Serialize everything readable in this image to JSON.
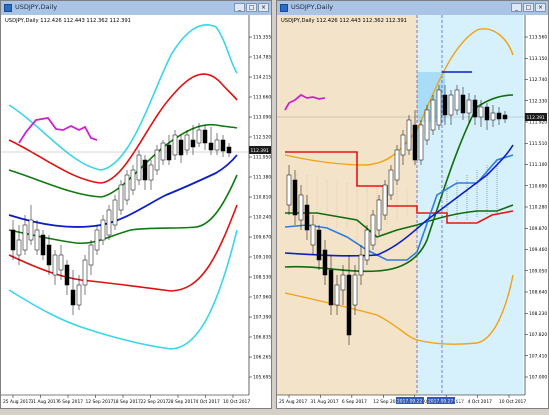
{
  "colors": {
    "bb1": "#39d7e6",
    "bb2": "#e01010",
    "bb3": "#0f7a0f",
    "mid": "#0b1ec8",
    "lagging": "#cc22cc",
    "candle_dark": "#000000",
    "candle_light": "#ffffff",
    "cloud_tan": "#f3e3c8",
    "cloud_cyan": "#bfeafb",
    "kijun": "#e81515",
    "tenkan": "#2d7de0",
    "senkou": "#0e6e0e",
    "orange": "#f3a212",
    "price_box": "#1c1c1c"
  },
  "left_window": {
    "title": "USDJPY,Daily",
    "header": "USDJPY,Daily  112.426 112.443 112.362 112.391",
    "price_label": "112.391",
    "y_ticks": [
      "115.355",
      "114.785",
      "114.215",
      "113.660",
      "113.090",
      "112.520",
      "111.950",
      "111.380",
      "110.810",
      "110.240",
      "109.670",
      "109.100",
      "108.530",
      "107.960",
      "107.390",
      "106.835",
      "106.265",
      "105.695"
    ],
    "x_ticks": [
      "25 Aug 2017",
      "31 Aug 2017",
      "6 Sep 2017",
      "12 Sep 2017",
      "18 Sep 2017",
      "22 Sep 2017",
      "28 Sep 2017",
      "4 Oct 2017",
      "10 Oct 2017"
    ]
  },
  "right_window": {
    "title": "USDJPY,Daily",
    "header": "USDJPY,Daily  112.426 112.443 112.362 112.391",
    "price_label": "112.391",
    "y_ticks": [
      "113.560",
      "113.150",
      "112.740",
      "112.330",
      "111.920",
      "111.510",
      "111.100",
      "110.690",
      "110.280",
      "109.870",
      "109.460",
      "109.050",
      "108.640",
      "108.230",
      "107.820",
      "107.410",
      "107.000"
    ],
    "x_ticks": [
      "25 Aug 2017",
      "31 Aug 2017",
      "6 Sep 2017",
      "12 Sep 2017",
      "18 Sep 2017",
      "26 Sep 2017",
      "4 Oct 2017",
      "10 Oct 2017"
    ],
    "highlight_label_1": "2017.09.22 00:00",
    "highlight_label_2": "2017.09.27 00:00"
  },
  "window_buttons": {
    "minimize": "_",
    "maximize": "□",
    "close": "×"
  }
}
